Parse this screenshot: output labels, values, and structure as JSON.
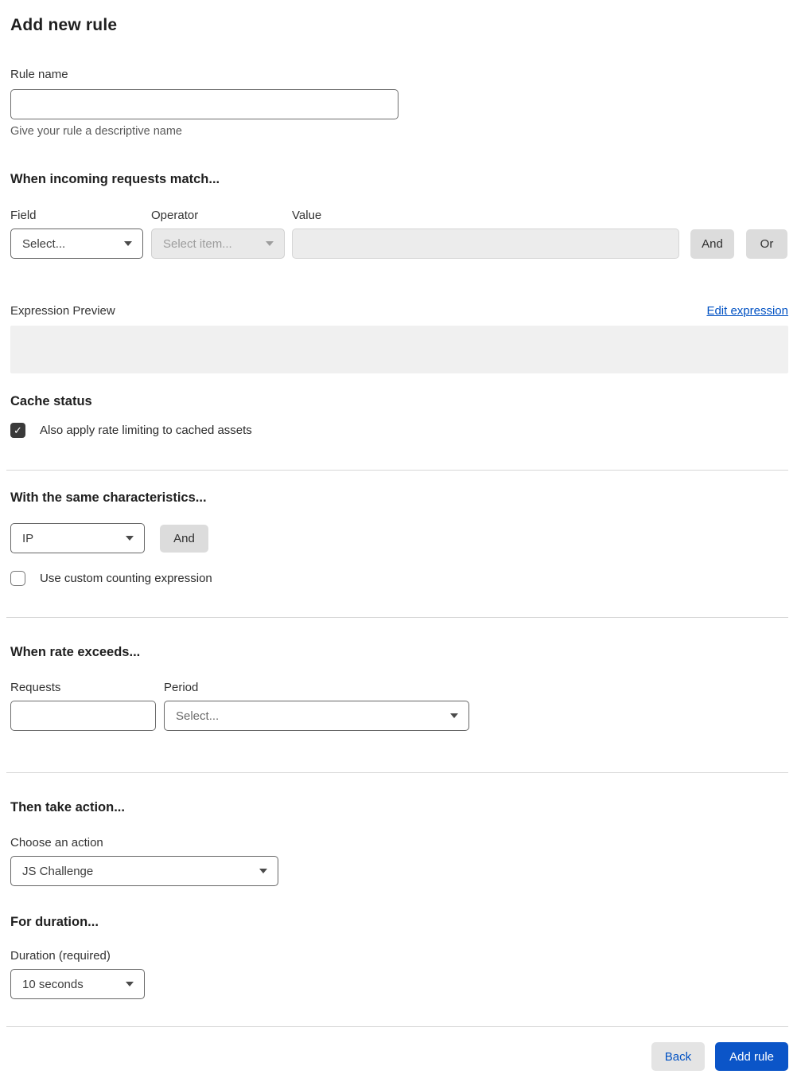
{
  "page": {
    "title": "Add new rule"
  },
  "rule_name": {
    "label": "Rule name",
    "value": "",
    "help": "Give your rule a descriptive name"
  },
  "match": {
    "heading": "When incoming requests match...",
    "field": {
      "label": "Field",
      "selected": "Select..."
    },
    "operator": {
      "label": "Operator",
      "selected": "Select item...",
      "disabled": true
    },
    "value": {
      "label": "Value",
      "value": "",
      "disabled": true
    },
    "and_label": "And",
    "or_label": "Or"
  },
  "expression": {
    "label": "Expression Preview",
    "edit_link": "Edit expression",
    "preview_text": ""
  },
  "cache": {
    "heading": "Cache status",
    "checkbox_label": "Also apply rate limiting to cached assets",
    "checked": true
  },
  "characteristics": {
    "heading": "With the same characteristics...",
    "selected": "IP",
    "and_label": "And",
    "checkbox_label": "Use custom counting expression",
    "checked": false
  },
  "rate": {
    "heading": "When rate exceeds...",
    "requests": {
      "label": "Requests",
      "value": ""
    },
    "period": {
      "label": "Period",
      "selected": "Select..."
    }
  },
  "action": {
    "heading": "Then take action...",
    "label": "Choose an action",
    "selected": "JS Challenge"
  },
  "duration": {
    "heading": "For duration...",
    "label": "Duration (required)",
    "selected": "10 seconds"
  },
  "footer": {
    "back_label": "Back",
    "submit_label": "Add rule"
  },
  "icons": {
    "checkmark": "✓"
  },
  "colors": {
    "link_blue": "#0051c3",
    "primary_button_blue": "#0b55c8",
    "checkbox_dark": "#3a3a3a",
    "disabled_gray": "#e9e9e9",
    "preview_gray": "#f0f0f0",
    "button_gray": "#dcdcdc"
  }
}
